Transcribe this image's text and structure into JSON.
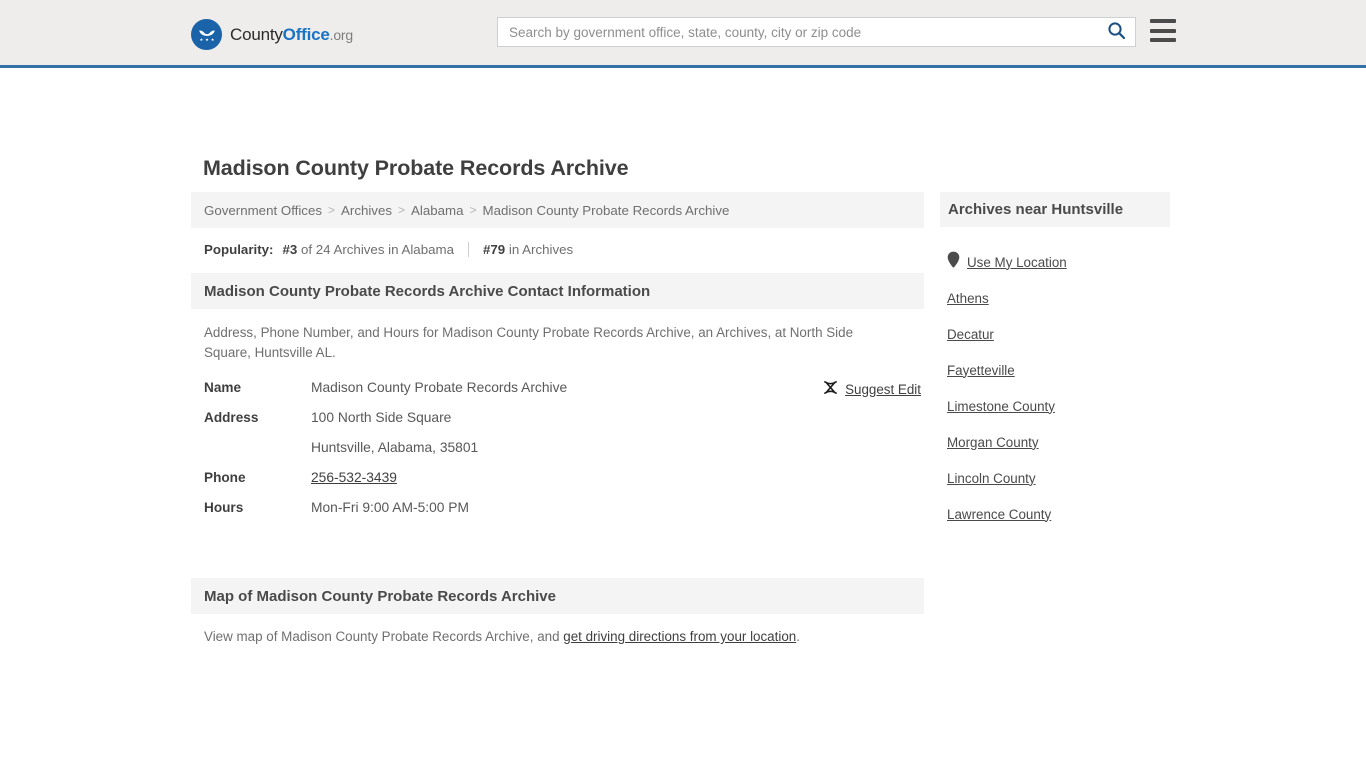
{
  "header": {
    "brand": {
      "part1": "County",
      "part2": "Office",
      "part3": ".org",
      "logo_icon": "eagle-stars-logo-icon"
    },
    "search": {
      "placeholder": "Search by government office, state, county, city or zip code",
      "value": "",
      "icon": "search-icon"
    },
    "menu_icon": "hamburger-menu-icon",
    "accent_color": "#3372a6",
    "background_color": "#eeedeb"
  },
  "page": {
    "title": "Madison County Probate Records Archive"
  },
  "breadcrumb": {
    "separator": ">",
    "items": [
      {
        "label": "Government Offices",
        "current": false
      },
      {
        "label": "Archives",
        "current": false
      },
      {
        "label": "Alabama",
        "current": false
      },
      {
        "label": "Madison County Probate Records Archive",
        "current": true
      }
    ]
  },
  "popularity": {
    "label": "Popularity:",
    "rank_state": "#3",
    "rank_state_suffix": "of 24 Archives in Alabama",
    "rank_overall": "#79",
    "rank_overall_suffix": "in Archives"
  },
  "contact_section": {
    "heading": "Madison County Probate Records Archive Contact Information",
    "description": "Address, Phone Number, and Hours for Madison County Probate Records Archive, an Archives, at North Side Square, Huntsville AL.",
    "suggest_edit": {
      "label": "Suggest Edit",
      "icon": "suggest-edit-icon"
    },
    "rows": [
      {
        "key": "Name",
        "value": "Madison County Probate Records Archive",
        "link": false
      },
      {
        "key": "Address",
        "value": "100 North Side Square",
        "link": false
      },
      {
        "key": "",
        "value": "Huntsville, Alabama, 35801",
        "link": false
      },
      {
        "key": "Phone",
        "value": "256-532-3439",
        "link": true
      },
      {
        "key": "Hours",
        "value": "Mon-Fri 9:00 AM-5:00 PM",
        "link": false
      }
    ]
  },
  "map_section": {
    "heading": "Map of Madison County Probate Records Archive",
    "description_prefix": "View map of Madison County Probate Records Archive, and ",
    "link_label": "get driving directions from your location",
    "description_suffix": "."
  },
  "sidebar": {
    "heading": "Archives near Huntsville",
    "items": [
      {
        "label": "Use My Location",
        "icon": "map-pin-icon"
      },
      {
        "label": "Athens",
        "icon": ""
      },
      {
        "label": "Decatur",
        "icon": ""
      },
      {
        "label": "Fayetteville",
        "icon": ""
      },
      {
        "label": "Limestone County",
        "icon": ""
      },
      {
        "label": "Morgan County",
        "icon": ""
      },
      {
        "label": "Lincoln County",
        "icon": ""
      },
      {
        "label": "Lawrence County",
        "icon": ""
      }
    ]
  }
}
